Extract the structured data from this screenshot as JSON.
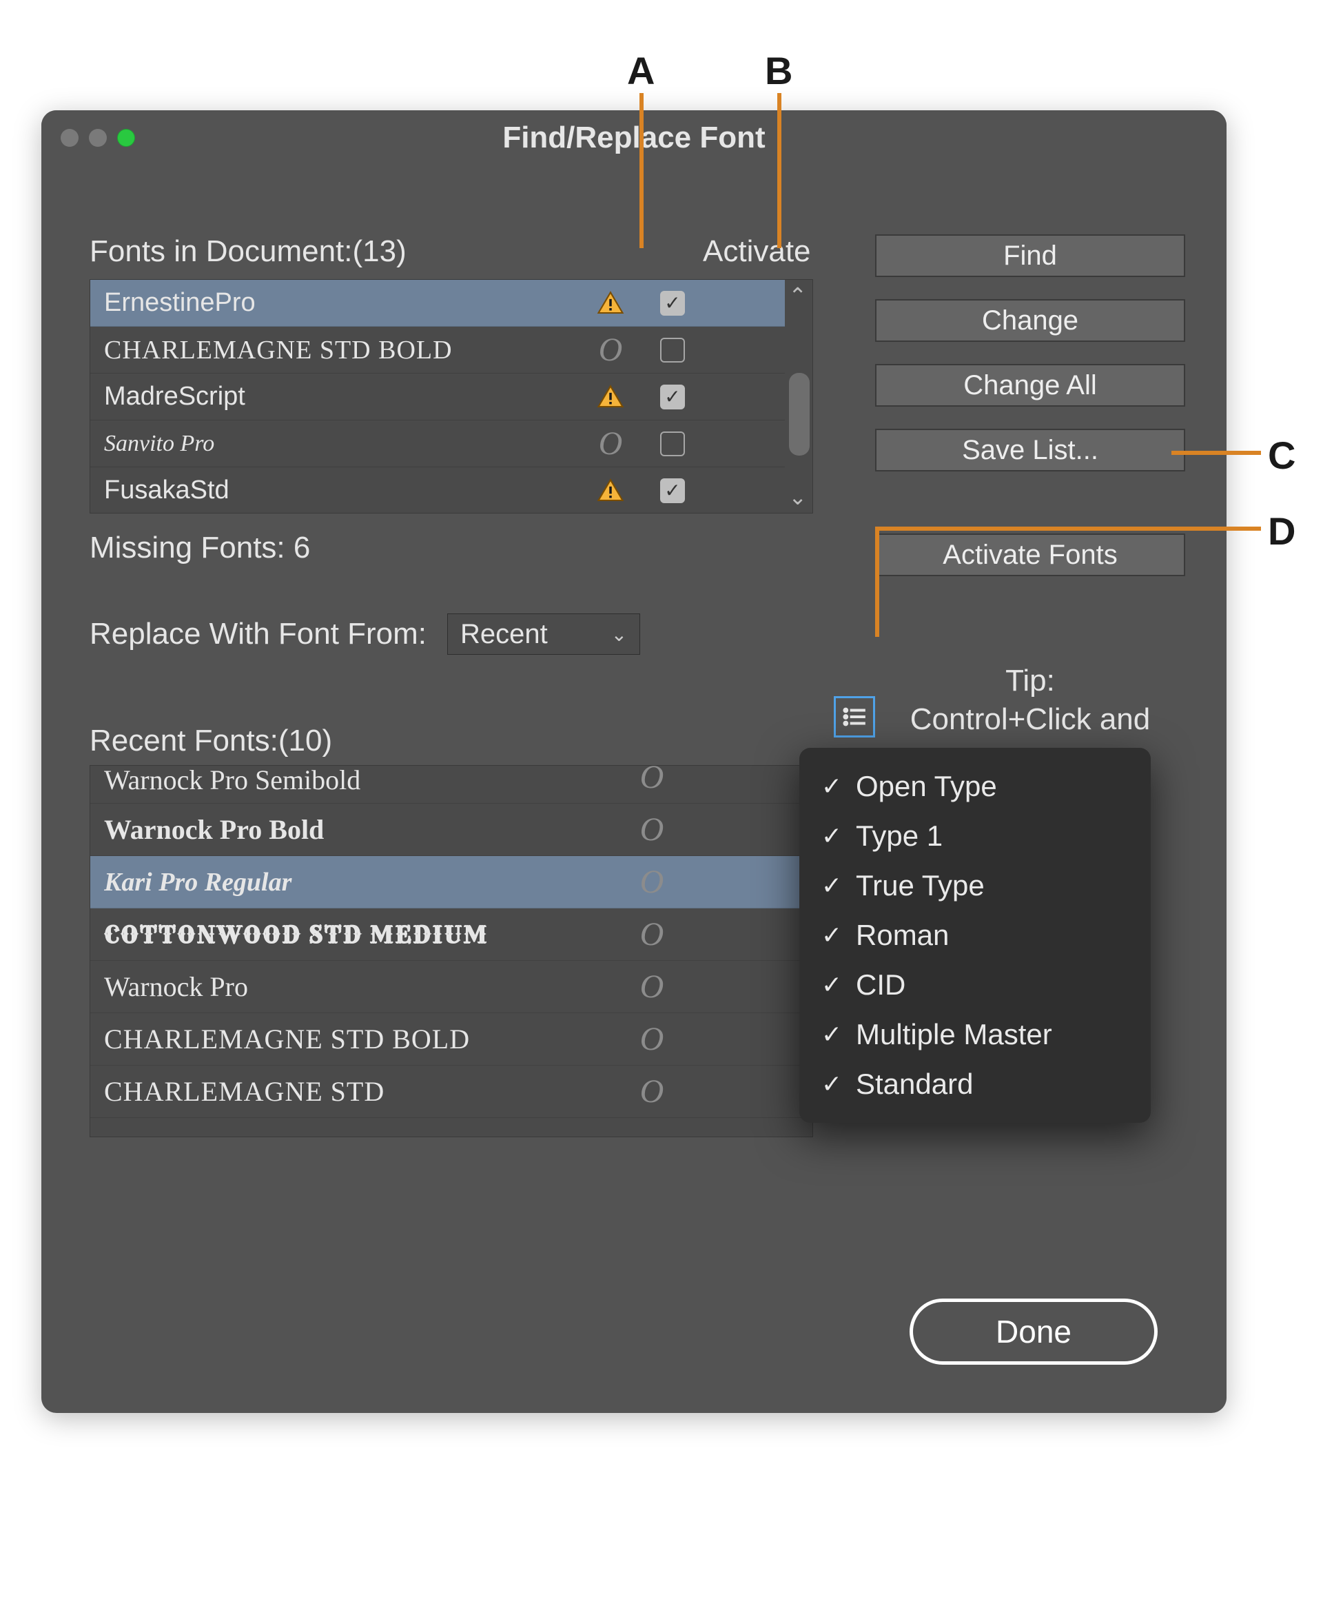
{
  "title": "Find/Replace Font",
  "labels": {
    "fonts_in_document": "Fonts in Document:(13)",
    "activate": "Activate",
    "missing_fonts": "Missing Fonts: 6",
    "replace_with": "Replace With Font From:",
    "recent_fonts": "Recent Fonts:(10)",
    "tip_line1": "Tip:",
    "tip_line2": "Control+Click and"
  },
  "dropdown": {
    "value": "Recent"
  },
  "buttons": {
    "find": "Find",
    "change": "Change",
    "change_all": "Change All",
    "save_list": "Save List...",
    "activate_fonts": "Activate Fonts",
    "done": "Done"
  },
  "doc_fonts": [
    {
      "name": "ErnestinePro",
      "missing": true,
      "checked": true,
      "selected": true,
      "style": ""
    },
    {
      "name": "CHARLEMAGNE STD BOLD",
      "missing": false,
      "checked": false,
      "selected": false,
      "style": "f-serifcaps"
    },
    {
      "name": "MadreScript",
      "missing": true,
      "checked": true,
      "selected": false,
      "style": ""
    },
    {
      "name": "Sanvito Pro",
      "missing": false,
      "checked": false,
      "selected": false,
      "style": "f-italic"
    },
    {
      "name": "FusakaStd",
      "missing": true,
      "checked": true,
      "selected": false,
      "style": ""
    }
  ],
  "recent_fonts": [
    {
      "name": "Warnock Pro Semibold",
      "selected": false,
      "style": "f-serif",
      "cut": true
    },
    {
      "name": "Warnock Pro Bold",
      "selected": false,
      "style": "f-serifbold"
    },
    {
      "name": "Kari Pro Regular",
      "selected": true,
      "style": "f-bolditalic"
    },
    {
      "name": "COTTONWOOD STD MEDIUM",
      "selected": false,
      "style": "f-western"
    },
    {
      "name": "Warnock Pro",
      "selected": false,
      "style": "f-serif"
    },
    {
      "name": "CHARLEMAGNE STD BOLD",
      "selected": false,
      "style": "f-serifcaps"
    },
    {
      "name": "CHARLEMAGNE STD",
      "selected": false,
      "style": "f-serifcaps"
    }
  ],
  "popup": [
    "Open Type",
    "Type 1",
    "True Type",
    "Roman",
    "CID",
    "Multiple Master",
    "Standard"
  ],
  "callouts": {
    "A": "A",
    "B": "B",
    "C": "C",
    "D": "D"
  }
}
